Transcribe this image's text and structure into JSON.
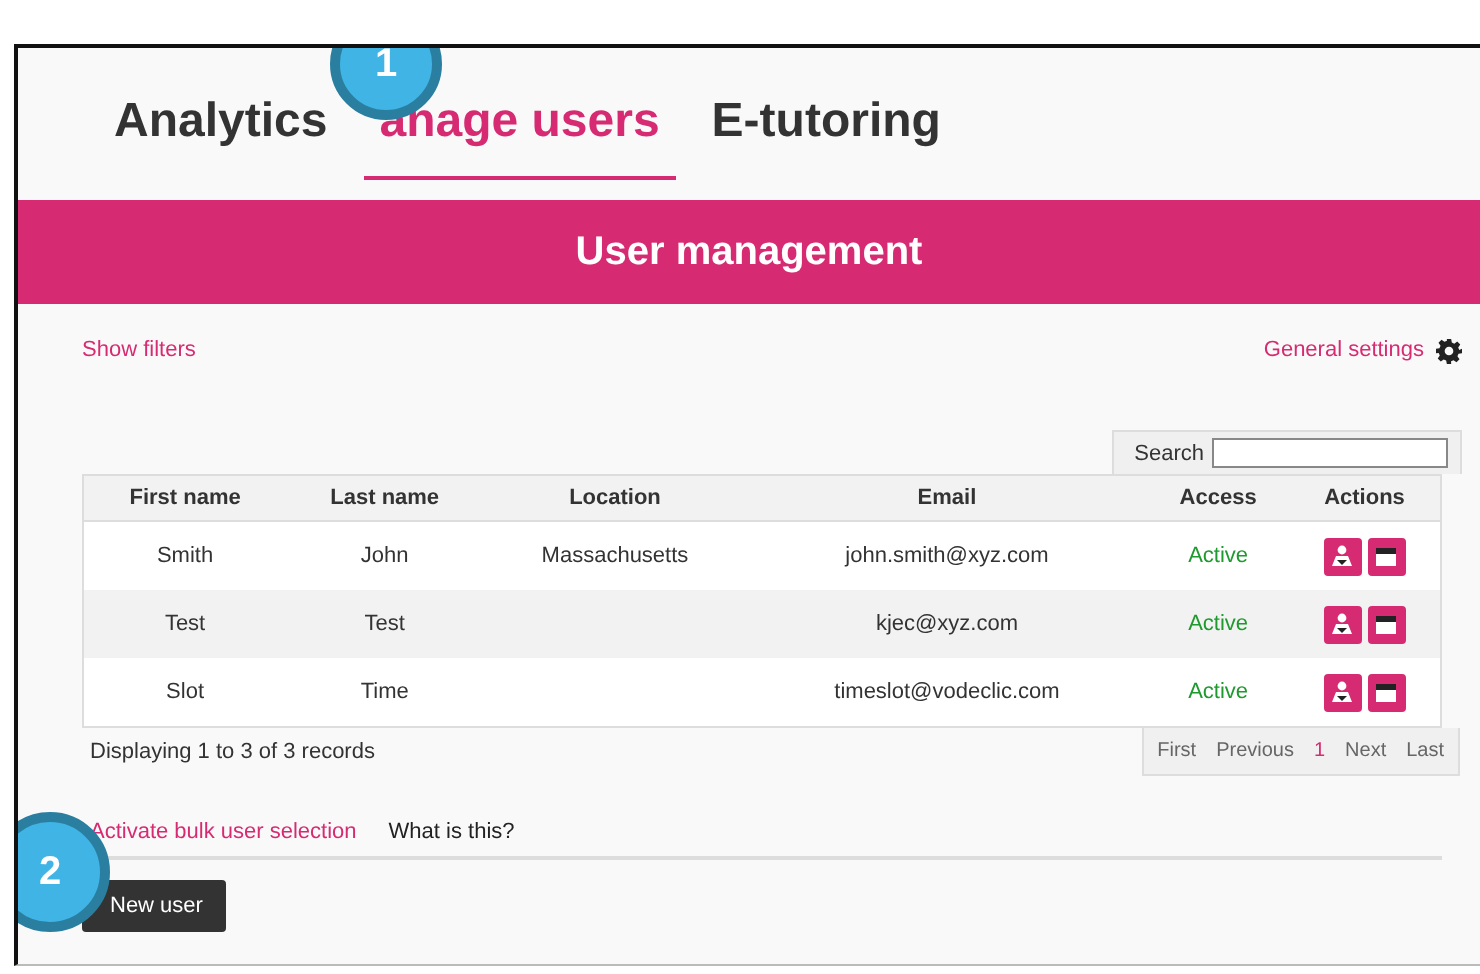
{
  "tabs": [
    {
      "label": "Analytics",
      "selected": false
    },
    {
      "label": "anage users",
      "selected": true
    },
    {
      "label": "E-tutoring",
      "selected": false
    }
  ],
  "banner": {
    "title": "User management"
  },
  "show_filters": "Show filters",
  "general_settings": "General settings",
  "search": {
    "label": "Search"
  },
  "table": {
    "columns": [
      "First name",
      "Last name",
      "Location",
      "Email",
      "Access",
      "Actions"
    ],
    "rows": [
      {
        "cells": [
          "Smith",
          "John",
          "Massachusetts",
          "john.smith@xyz.com",
          "Active"
        ]
      },
      {
        "cells": [
          "Test",
          "Test",
          "",
          "kjec@xyz.com",
          "Active"
        ]
      },
      {
        "cells": [
          "Slot",
          "Time",
          "",
          "timeslot@vodeclic.com",
          "Active"
        ]
      }
    ]
  },
  "records_info": "Displaying 1 to 3 of 3 records",
  "pagination": [
    {
      "label": "First",
      "selected": false
    },
    {
      "label": "Previous",
      "selected": false
    },
    {
      "label": "1",
      "selected": true
    },
    {
      "label": "Next",
      "selected": false
    },
    {
      "label": "Last",
      "selected": false
    }
  ],
  "bulk_link": "Activate bulk user selection",
  "help_link": "What is this?",
  "new_user_button": "New user",
  "callouts": [
    "1",
    "2"
  ]
}
